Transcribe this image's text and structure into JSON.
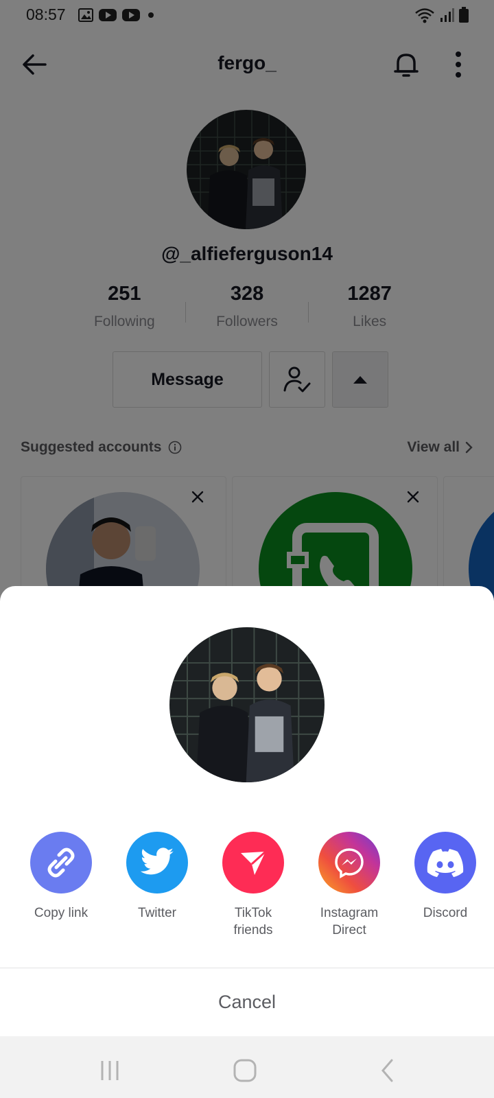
{
  "status_bar": {
    "time": "08:57",
    "notification_icons": [
      "gallery-icon",
      "youtube-icon",
      "youtube-icon",
      "dot-icon"
    ],
    "system_icons": [
      "wifi-icon",
      "signal-icon",
      "battery-icon"
    ]
  },
  "header": {
    "title": "fergo_",
    "icons": [
      "back-arrow-icon",
      "bell-icon",
      "more-vertical-icon"
    ]
  },
  "profile": {
    "handle": "@_alfieferguson14",
    "stats": [
      {
        "value": "251",
        "label": "Following"
      },
      {
        "value": "328",
        "label": "Followers"
      },
      {
        "value": "1287",
        "label": "Likes"
      }
    ],
    "message_label": "Message",
    "friend_icon": "user-check-icon",
    "toggle_icon": "caret-up-icon"
  },
  "suggested": {
    "title": "Suggested accounts",
    "info_icon": "info-icon",
    "view_all_label": "View all",
    "view_all_icon": "chevron-right-icon"
  },
  "share_sheet": {
    "options": [
      {
        "label": "Copy link",
        "icon": "link-icon",
        "color": "#6a7cf0"
      },
      {
        "label": "Twitter",
        "icon": "twitter-icon",
        "color": "#1d9bf0"
      },
      {
        "label": "TikTok\nfriends",
        "icon": "send-icon",
        "color": "#fe2c55"
      },
      {
        "label": "Instagram\nDirect",
        "icon": "messenger-icon",
        "color": "#d6249f"
      },
      {
        "label": "Discord",
        "icon": "discord-icon",
        "color": "#5865f2"
      }
    ],
    "cancel_label": "Cancel"
  },
  "nav_bar": {
    "icons": [
      "recent-apps-icon",
      "home-icon",
      "back-icon"
    ]
  }
}
